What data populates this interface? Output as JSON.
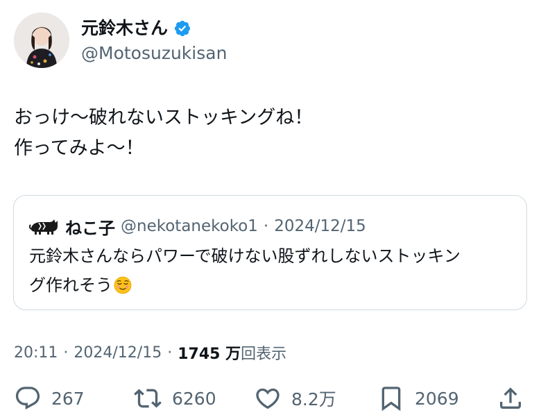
{
  "author": {
    "display_name": "元鈴木さん",
    "handle": "@Motosuzukisan",
    "verified_color": "#1d9bf0"
  },
  "tweet": {
    "lines": [
      "おっけ〜破れないストッキングね！",
      "作ってみよ〜！"
    ]
  },
  "quote": {
    "avatar_icon": "cat-avatar-icon",
    "display_name": "ねこ子",
    "handle": "@nekotanekoko1",
    "separator": "·",
    "date": "2024/12/15",
    "lines": [
      "元鈴木さんならパワーで破けない股ずれしないストッキン",
      "グ作れそう"
    ],
    "emoji": "relieved-face-emoji"
  },
  "meta": {
    "time": "20:11",
    "sep1": "·",
    "date": "2024/12/15",
    "sep2": "·",
    "views_count": "1745 万",
    "views_label": "回表示"
  },
  "actions": {
    "reply_count": "267",
    "retweet_count": "6260",
    "like_count": "8.2万",
    "bookmark_count": "2069"
  },
  "colors": {
    "text_primary": "#0f1419",
    "text_secondary": "#536471",
    "border": "#cfd9de"
  }
}
